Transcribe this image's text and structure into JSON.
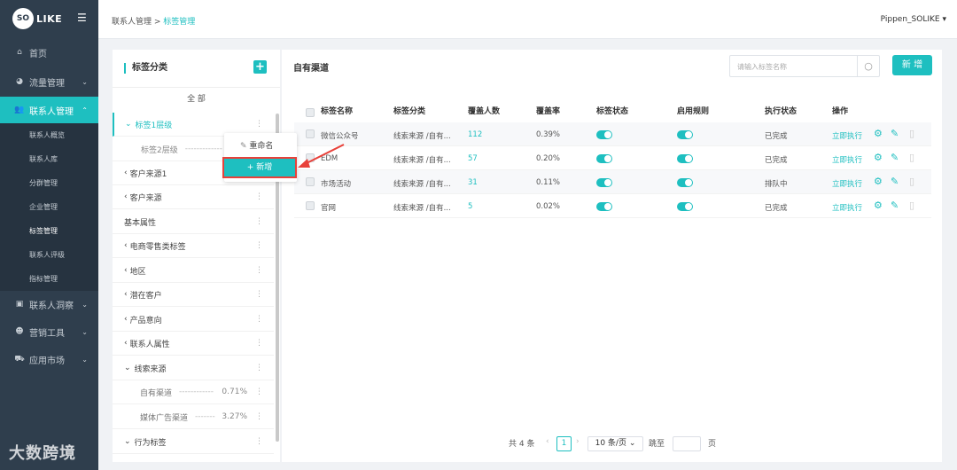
{
  "app": {
    "logo_so": "SO",
    "logo_like": "LIKE"
  },
  "sidebar": {
    "items": [
      {
        "label": "首页",
        "icon": "home-icon",
        "glyph": "⌂"
      },
      {
        "label": "流量管理",
        "icon": "pie-chart-icon",
        "glyph": "◕"
      },
      {
        "label": "联系人管理",
        "icon": "users-icon",
        "glyph": "👥"
      },
      {
        "label": "联系人洞察",
        "icon": "id-card-icon",
        "glyph": "▣"
      },
      {
        "label": "营销工具",
        "icon": "people-icon",
        "glyph": "☻"
      },
      {
        "label": "应用市场",
        "icon": "cart-icon",
        "glyph": "⛟"
      }
    ],
    "subitems": [
      "联系人概览",
      "联系人库",
      "分群管理",
      "企业管理",
      "标签管理",
      "联系人评级",
      "指标管理"
    ]
  },
  "header": {
    "breadcrumb_parent": "联系人管理",
    "breadcrumb_sep": " > ",
    "breadcrumb_current": "标签管理",
    "user": "Pippen_SOLIKE"
  },
  "left_panel": {
    "title": "标签分类",
    "all": "全 部",
    "tree": [
      {
        "label": "标签1层级",
        "prefix": "⌄"
      },
      {
        "label": "标签2层级",
        "prefix": ""
      },
      {
        "label": "客户来源1",
        "prefix": "‹"
      },
      {
        "label": "客户来源",
        "prefix": "‹"
      },
      {
        "label": "基本属性",
        "prefix": ""
      },
      {
        "label": "电商零售类标签",
        "prefix": "‹"
      },
      {
        "label": "地区",
        "prefix": "‹"
      },
      {
        "label": "潜在客户",
        "prefix": "‹"
      },
      {
        "label": "产品意向",
        "prefix": "‹"
      },
      {
        "label": "联系人属性",
        "prefix": "‹"
      },
      {
        "label": "线索来源",
        "prefix": "⌄"
      },
      {
        "label": "自有渠道",
        "prefix": "",
        "dashes": "------------",
        "pct": "0.71%"
      },
      {
        "label": "媒体广告渠道",
        "prefix": "",
        "dashes": "-------",
        "pct": "3.27%"
      },
      {
        "label": "行为标签",
        "prefix": "⌄"
      }
    ],
    "popup": {
      "rename": "重命名",
      "new": "+ 新增"
    }
  },
  "main": {
    "title": "自有渠道",
    "search_placeholder": "请输入标签名称",
    "new_button": "新 增",
    "columns": [
      "标签名称",
      "标签分类",
      "覆盖人数",
      "覆盖率",
      "标签状态",
      "启用规则",
      "执行状态",
      "操作"
    ],
    "rows": [
      {
        "name": "微信公众号",
        "category": "线索来源 /自有...",
        "count": "112",
        "rate": "0.39%",
        "exec": "已完成",
        "action": "立即执行"
      },
      {
        "name": "EDM",
        "category": "线索来源 /自有...",
        "count": "57",
        "rate": "0.20%",
        "exec": "已完成",
        "action": "立即执行"
      },
      {
        "name": "市场活动",
        "category": "线索来源 /自有...",
        "count": "31",
        "rate": "0.11%",
        "exec": "排队中",
        "action": "立即执行"
      },
      {
        "name": "官网",
        "category": "线索来源 /自有...",
        "count": "5",
        "rate": "0.02%",
        "exec": "已完成",
        "action": "立即执行"
      }
    ],
    "pager": {
      "total": "共 4 条",
      "page": "1",
      "page_size": "10 条/页",
      "goto": "跳至",
      "page_unit": "页"
    }
  },
  "watermark": "大数跨境",
  "colors": {
    "accent": "#1ebfc0",
    "sidebar": "#2f3e4d",
    "highlight": "#e8413a"
  }
}
